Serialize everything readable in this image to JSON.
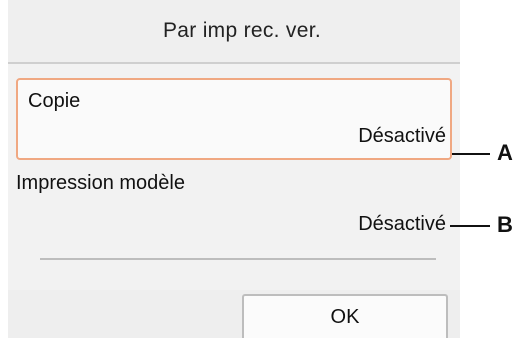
{
  "header": {
    "title": "Par imp rec. ver."
  },
  "settings": {
    "items": [
      {
        "label": "Copie",
        "value": "Désactivé"
      },
      {
        "label": "Impression modèle",
        "value": "Désactivé"
      }
    ]
  },
  "footer": {
    "ok_label": "OK"
  },
  "callouts": {
    "a": "A",
    "b": "B"
  },
  "colors": {
    "selection_border": "#f0a882",
    "background": "#eeeeee"
  }
}
